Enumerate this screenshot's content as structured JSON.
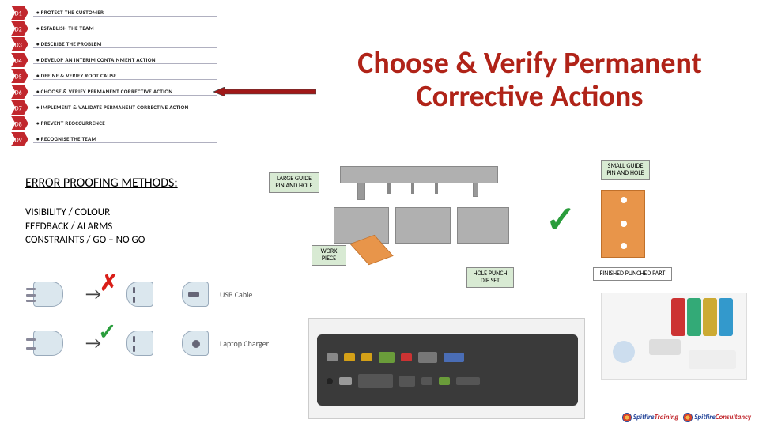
{
  "d_steps": [
    {
      "code": "D1",
      "label": "PROTECT THE CUSTOMER"
    },
    {
      "code": "D2",
      "label": "ESTABLISH THE TEAM"
    },
    {
      "code": "D3",
      "label": "DESCRIBE THE PROBLEM"
    },
    {
      "code": "D4",
      "label": "DEVELOP AN INTERIM CONTAINMENT ACTION"
    },
    {
      "code": "D5",
      "label": "DEFINE & VERIFY ROOT CAUSE"
    },
    {
      "code": "D6",
      "label": "CHOOSE & VERIFY PERMANENT CORRECTIVE ACTION"
    },
    {
      "code": "D7",
      "label": "IMPLEMENT & VALIDATE PERMANENT CORRECTIVE ACTION"
    },
    {
      "code": "D8",
      "label": "PREVENT REOCCURRENCE"
    },
    {
      "code": "D9",
      "label": "RECOGNISE THE TEAM"
    }
  ],
  "title": "Choose & Verify Permanent Corrective Actions",
  "section_header": "ERROR PROOFING METHODS:",
  "methods": [
    "VISIBILITY / COLOUR",
    "FEEDBACK / ALARMS",
    "CONSTRAINTS / GO – NO GO"
  ],
  "diagram_labels": {
    "large_guide": "LARGE GUIDE PIN AND HOLE",
    "small_guide": "SMALL GUIDE PIN AND HOLE",
    "work_piece": "WORK PIECE",
    "die_set": "HOLE PUNCH DIE SET",
    "finished": "FINISHED PUNCHED PART"
  },
  "plug_labels": {
    "usb": "USB Cable",
    "charger": "Laptop Charger"
  },
  "logos": {
    "training": {
      "word1": "Spitfire",
      "word2": "Training"
    },
    "consultancy": {
      "word1": "Spitfire",
      "word2": "Consultancy"
    }
  }
}
